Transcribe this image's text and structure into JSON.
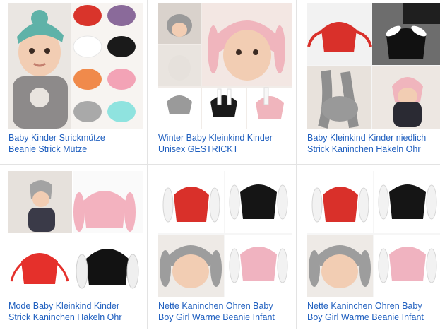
{
  "products": [
    {
      "line1": "Baby Kinder Strickmütze",
      "line2": "Beanie Strick Mütze",
      "image": "baby-turban-hats-collage"
    },
    {
      "line1": "Winter Baby Kleinkind Kinder",
      "line2": "Unisex GESTRICKT",
      "image": "baby-bunny-ear-hat-collage"
    },
    {
      "line1": "Baby Kleinkind Kinder niedlich",
      "line2": "Strick Kaninchen Häkeln Ohr",
      "image": "bunny-ear-hats-photos"
    },
    {
      "line1": "Mode Baby Kleinkind Kinder",
      "line2": "Strick Kaninchen Häkeln Ohr",
      "image": "baby-in-bunny-hat-and-hats"
    },
    {
      "line1": "Nette Kaninchen Ohren Baby",
      "line2": "Boy Girl Warme Beanie Infant",
      "image": "bunny-beanie-color-grid"
    },
    {
      "line1": "Nette Kaninchen Ohren Baby",
      "line2": "Boy Girl Warme Beanie Infant",
      "image": "bunny-beanie-color-grid"
    }
  ],
  "colors": {
    "link": "#1f5fbf",
    "divider": "#e3e3e3"
  }
}
